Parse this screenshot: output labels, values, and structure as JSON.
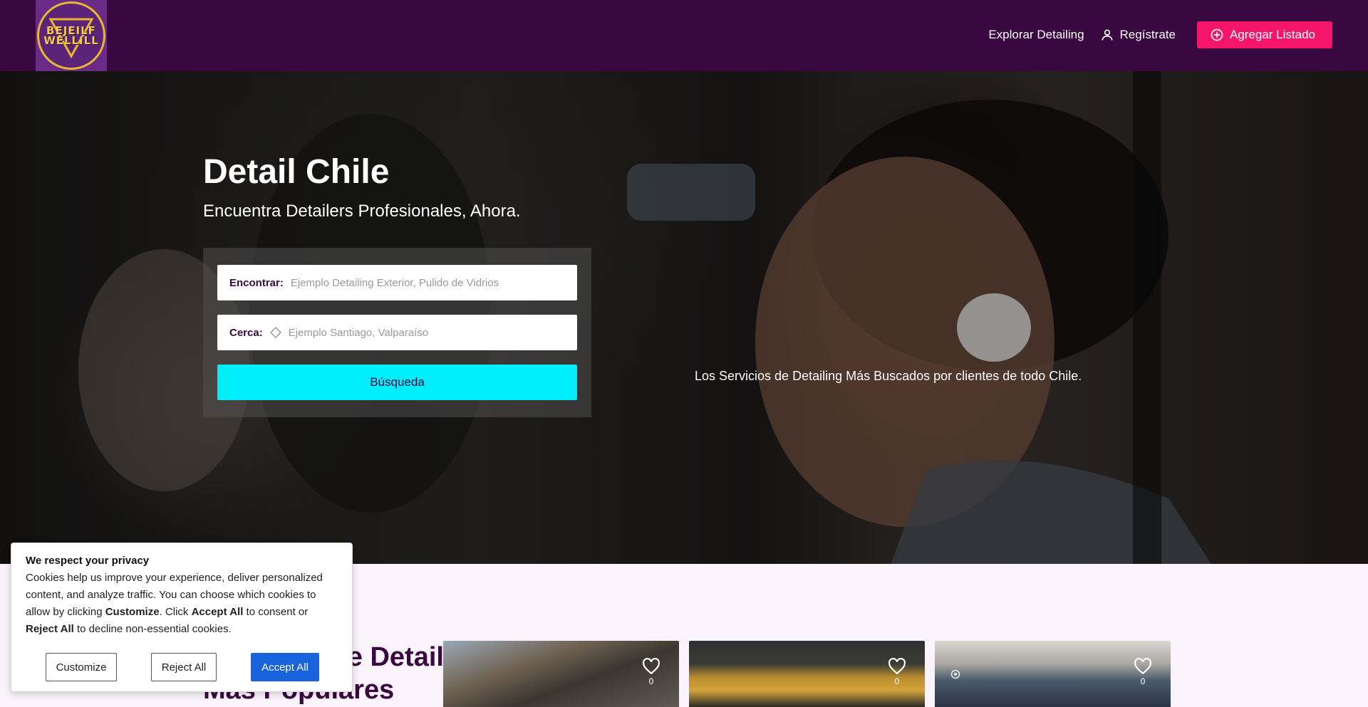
{
  "brand": {
    "logo_text_top": "BEJEILF",
    "logo_text_bottom": "WELLILL"
  },
  "nav": {
    "explore": "Explorar Detailing",
    "register": "Regístrate",
    "add_listing": "Agregar Listado"
  },
  "hero": {
    "title": "Detail Chile",
    "subtitle": "Encuentra Detailers Profesionales, Ahora.",
    "search": {
      "find_label": "Encontrar:",
      "find_placeholder": "Ejemplo Detailing Exterior, Pulido de Vidrios",
      "near_label": "Cerca:",
      "near_placeholder": "Ejemplo Santiago, Valparaíso",
      "button": "Búsqueda"
    },
    "tagline": "Los Servicios de Detailing Más Buscados por clientes de todo Chile."
  },
  "popular": {
    "title_line1": "Servicios de Detailing",
    "title_line2": "Más Populares",
    "cards": [
      {
        "likes": "0"
      },
      {
        "likes": "0"
      },
      {
        "likes": "0"
      }
    ]
  },
  "cookie": {
    "title": "We respect your privacy",
    "text_1": "Cookies help us improve your experience, deliver personalized content, and analyze traffic. You can choose which cookies to allow by clicking ",
    "customize_word": "Customize",
    "text_2": ". Click ",
    "accept_word": "Accept All",
    "text_3": " to consent or ",
    "reject_word": "Reject All",
    "text_4": " to decline non-essential cookies.",
    "btn_customize": "Customize",
    "btn_reject": "Reject All",
    "btn_accept": "Accept All"
  },
  "colors": {
    "header_bg": "#3a0840",
    "cta": "#f5156a",
    "search_button": "#00eefc",
    "accept_button": "#1863dc"
  }
}
